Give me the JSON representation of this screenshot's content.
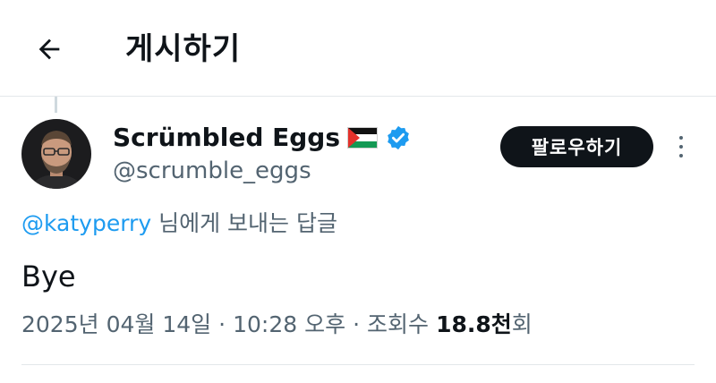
{
  "header": {
    "title": "게시하기",
    "back_icon": "arrow-left-icon"
  },
  "author": {
    "display_name": "Scrümbled Eggs",
    "flag_icon": "palestine-flag-icon",
    "verified_icon": "verified-badge-icon",
    "verified_color": "#1d9bf0",
    "handle": "@scrumble_eggs",
    "follow_label": "팔로우하기",
    "more_icon": "more-vertical-icon"
  },
  "reply": {
    "mention": "@katyperry",
    "suffix": " 님에게 보내는 답글"
  },
  "post": {
    "text": "Bye"
  },
  "meta": {
    "date": "2025년 04월 14일",
    "separator": "·",
    "time": "10:28 오후",
    "views_label": "조회수",
    "views_count": "18.8천",
    "views_unit": "회"
  },
  "colors": {
    "text": "#0f1419",
    "muted": "#536471",
    "link": "#1d9bf0",
    "button_bg": "#0f1419"
  }
}
